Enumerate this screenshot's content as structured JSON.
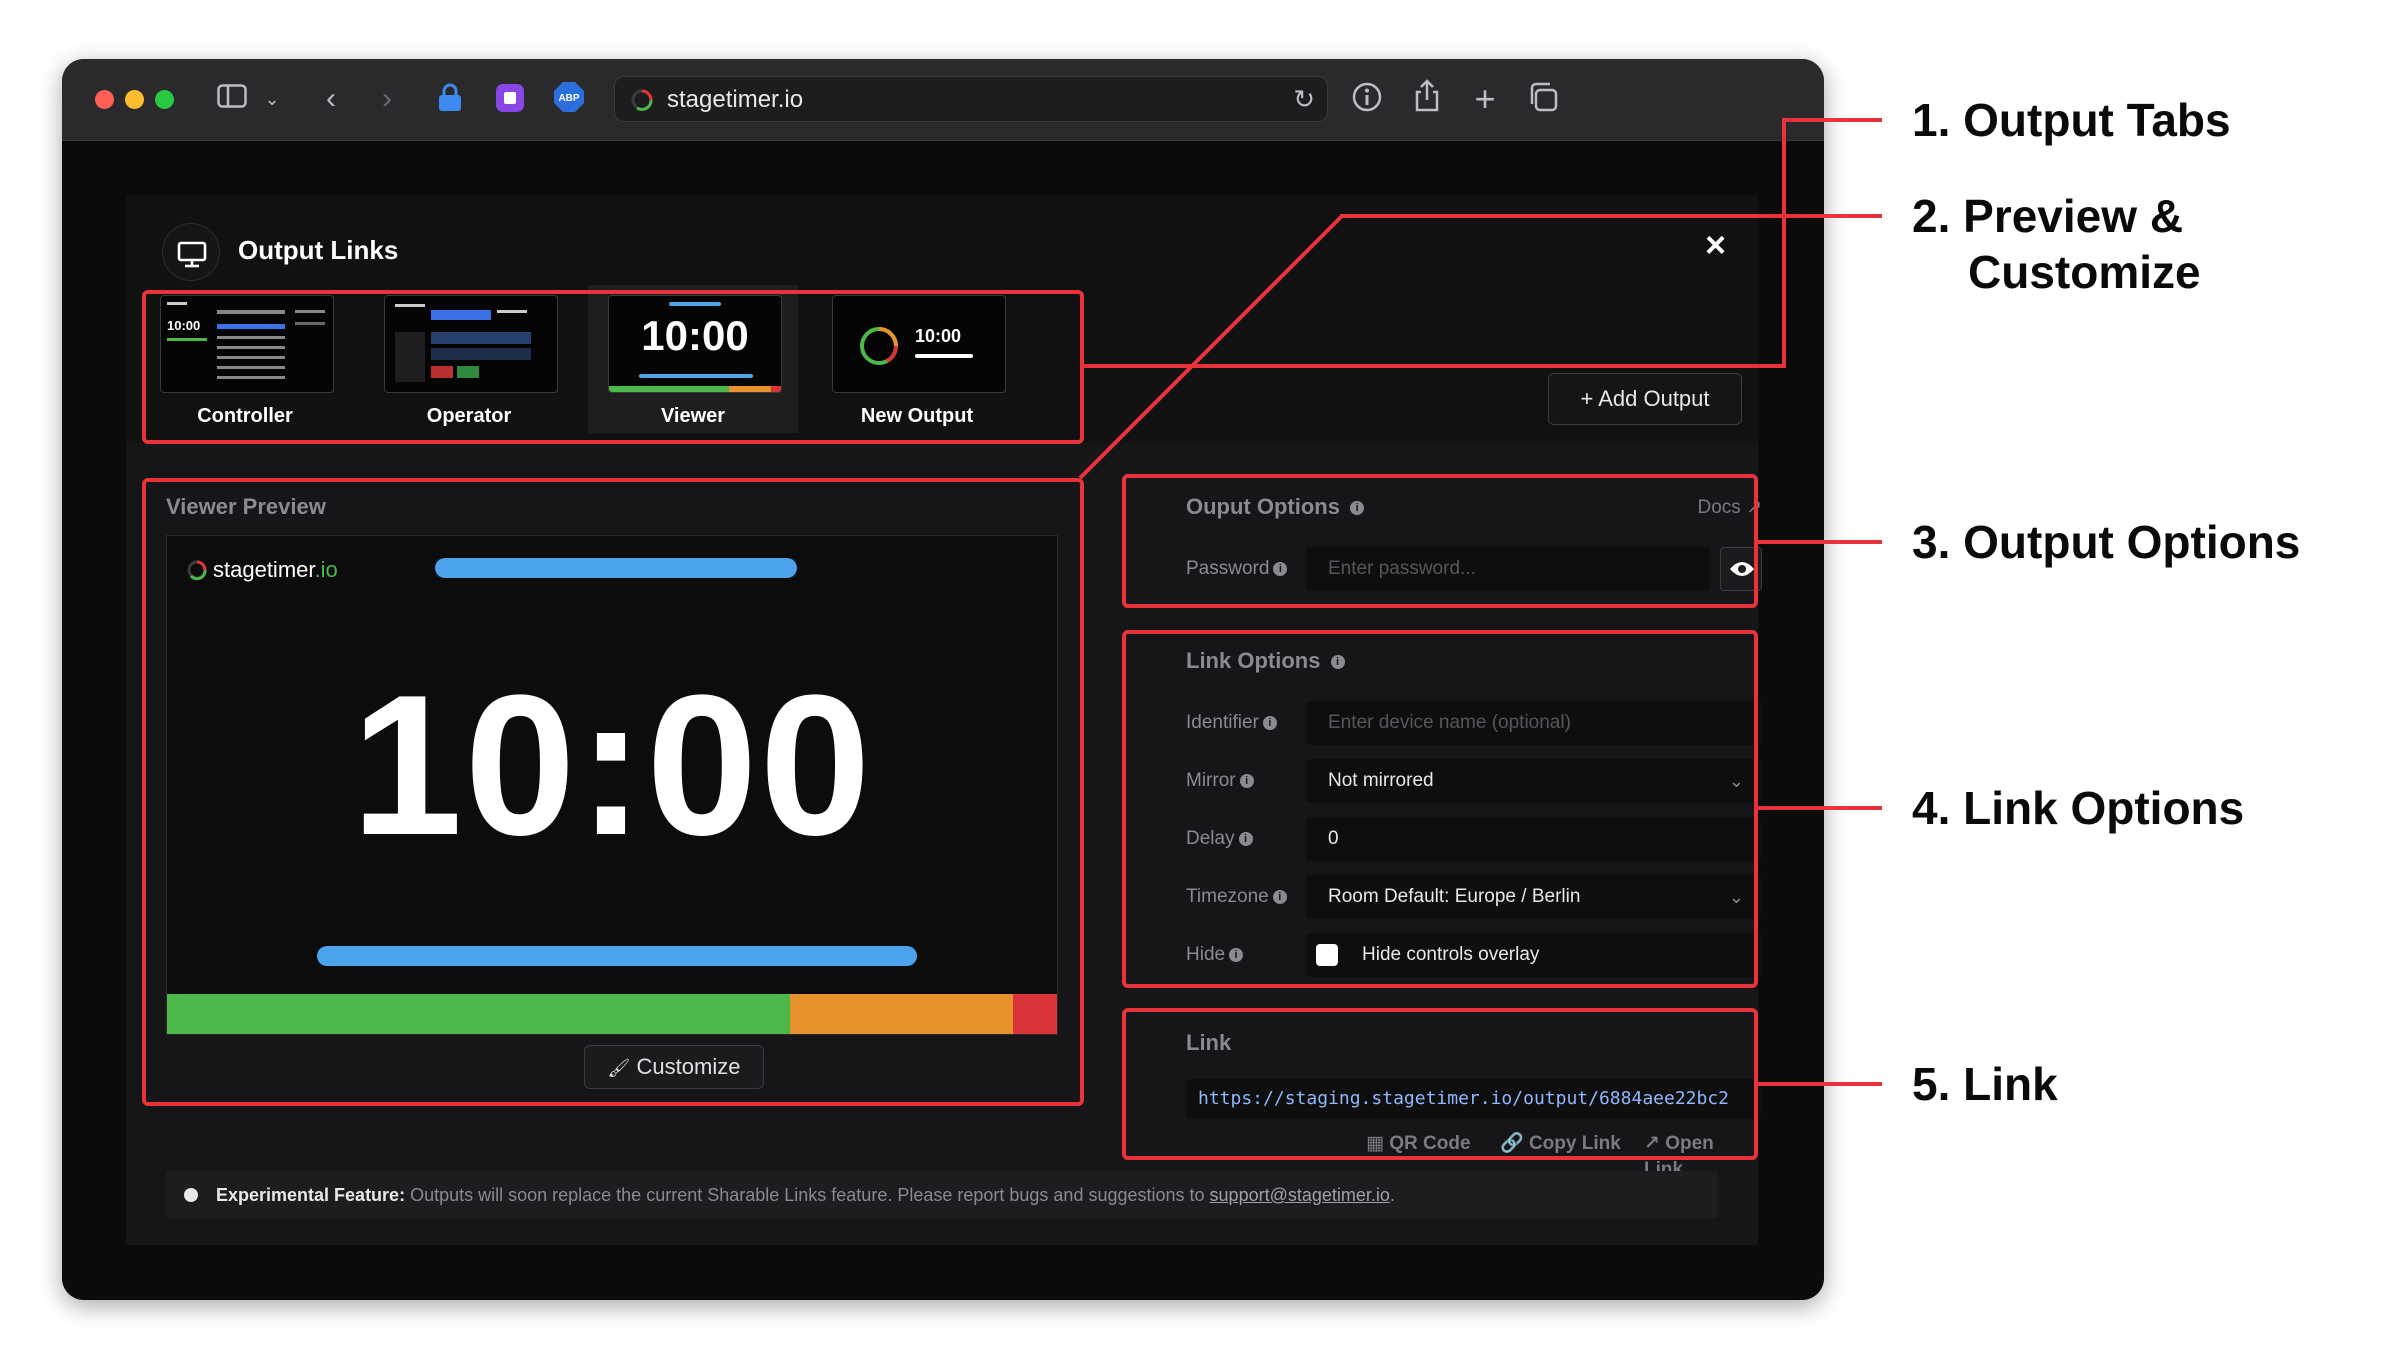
{
  "browser": {
    "url": "stagetimer.io",
    "colors": {
      "close": "#ff5f57",
      "minimize": "#febc2e",
      "zoom": "#28c840"
    }
  },
  "modal": {
    "title": "Output Links",
    "close_icon": "×",
    "add_output_label": "+ Add Output",
    "tabs": [
      {
        "label": "Controller",
        "icon": "controller-thumbnail",
        "thumb_time": "10:00"
      },
      {
        "label": "Operator",
        "icon": "operator-thumbnail"
      },
      {
        "label": "Viewer",
        "icon": "viewer-thumbnail",
        "thumb_time": "10:00",
        "active": true
      },
      {
        "label": "New Output",
        "icon": "new-output-thumbnail",
        "thumb_time": "10:00"
      }
    ],
    "preview": {
      "label": "Viewer Preview",
      "logo_text": "stagetimer",
      "logo_suffix": ".io",
      "time": "10:00",
      "customize_label": "Customize",
      "progress_colors": [
        "#4cb84a",
        "#e8922e",
        "#d8343a"
      ]
    },
    "output_options": {
      "title": "Ouput Options",
      "docs_label": "Docs",
      "password_label": "Password",
      "password_placeholder": "Enter password..."
    },
    "link_options": {
      "title": "Link Options",
      "identifier_label": "Identifier",
      "identifier_placeholder": "Enter device name (optional)",
      "mirror_label": "Mirror",
      "mirror_value": "Not mirrored",
      "delay_label": "Delay",
      "delay_value": "0",
      "timezone_label": "Timezone",
      "timezone_value": "Room Default: Europe / Berlin",
      "hide_label": "Hide",
      "hide_checkbox_label": "Hide controls overlay"
    },
    "link": {
      "title": "Link",
      "url": "https://staging.stagetimer.io/output/6884aee22bc2",
      "qr_label": "QR Code",
      "copy_label": "Copy Link",
      "open_label": "Open Link"
    },
    "footer": {
      "prefix": "Experimental Feature:",
      "text": " Outputs will soon replace the current Sharable Links feature. Please report bugs and suggestions to ",
      "email": "support@stagetimer.io",
      "suffix": "."
    }
  },
  "annotations": {
    "a1": "1. Output Tabs",
    "a2_line1": "2. Preview &",
    "a2_line2": "Customize",
    "a3": "3. Output Options",
    "a4": "4. Link Options",
    "a5": "5. Link"
  },
  "annotation_color": "#e8333a"
}
